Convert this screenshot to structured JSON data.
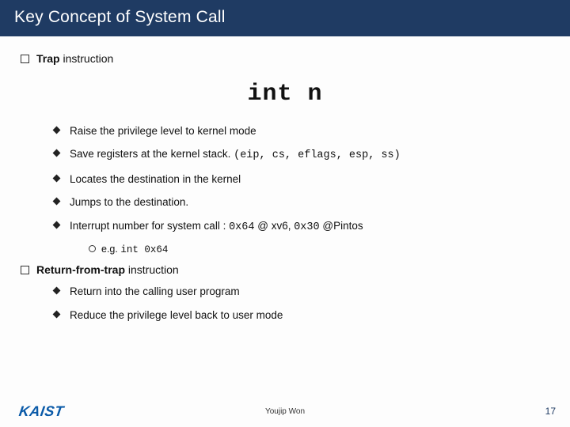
{
  "title": "Key Concept of System Call",
  "section1": {
    "bold": "Trap",
    "rest": " instruction"
  },
  "centered": "int n",
  "bullets1": [
    {
      "text": "Raise the privilege level to kernel mode"
    },
    {
      "text": "Save registers at the kernel stack. ",
      "code": "(eip, cs, eflags, esp, ss)"
    },
    {
      "text": "Locates the destination in the kernel"
    },
    {
      "text": "Jumps to the destination."
    },
    {
      "text": "Interrupt number for system call : ",
      "code1": "0x64",
      "mid1": " @ xv6, ",
      "code2": "0x30",
      "mid2": " @Pintos"
    }
  ],
  "subcircle": {
    "prefix": "e.g. ",
    "code": "int 0x64"
  },
  "section2": {
    "bold": "Return-from-trap",
    "rest": " instruction"
  },
  "bullets2": [
    {
      "text": "Return into the calling user program"
    },
    {
      "text": "Reduce the privilege level back to user mode"
    }
  ],
  "footer": {
    "logo": "KAIST",
    "author": "Youjip Won",
    "page": "17"
  }
}
